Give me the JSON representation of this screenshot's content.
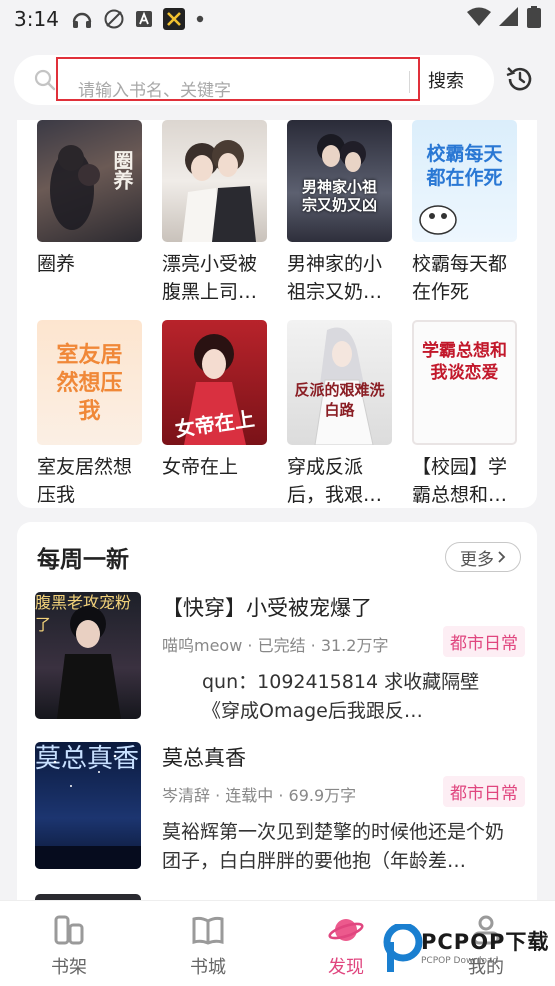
{
  "status": {
    "time": "3:14"
  },
  "search": {
    "placeholder": "请输入书名、关键字",
    "button": "搜索"
  },
  "grid_books": [
    {
      "title": "圈养",
      "cover_text": "圈养"
    },
    {
      "title": "漂亮小受被腹黑上司…",
      "cover_text": ""
    },
    {
      "title": "男神家的小祖宗又奶…",
      "cover_text": "男神家小祖宗又奶又凶"
    },
    {
      "title": "校霸每天都在作死",
      "cover_text": "校霸每天都在作死"
    },
    {
      "title": "室友居然想压我",
      "cover_text": "室友居然想压我"
    },
    {
      "title": "女帝在上",
      "cover_text": "女帝在上"
    },
    {
      "title": "穿成反派后，我艰…",
      "cover_text": "反派的艰难洗白路"
    },
    {
      "title": "【校园】学霸总想和…",
      "cover_text": "学霸总想和我谈恋爱"
    }
  ],
  "weekly": {
    "title": "每周一新",
    "more": "更多",
    "entries": [
      {
        "title": "【快穿】小受被宠爆了",
        "meta": "喵呜meow · 已完结 · 31.2万字",
        "tag": "都市日常",
        "desc": "qun：1092415814 求收藏隔壁《穿成Omage后我跟反…",
        "cover_text": "腹黑老攻宠粉了"
      },
      {
        "title": "莫总真香",
        "meta": "岑清辞 · 连载中 · 69.9万字",
        "tag": "都市日常",
        "desc": "莫裕辉第一次见到楚擎的时候他还是个奶团子，白白胖胖的要他抱（年龄差…",
        "cover_text": "莫总真香"
      }
    ]
  },
  "nav": [
    {
      "label": "书架",
      "icon": "bookshelf-icon"
    },
    {
      "label": "书城",
      "icon": "book-open-icon"
    },
    {
      "label": "发现",
      "icon": "planet-icon",
      "active": true
    },
    {
      "label": "我的",
      "icon": "user-icon"
    }
  ],
  "watermark": {
    "brand": "PCPOP下载",
    "sub": "PCPOP Download"
  },
  "colors": {
    "accent": "#e0467f",
    "search_outline": "#e0303a",
    "background": "#f3f3f5"
  }
}
